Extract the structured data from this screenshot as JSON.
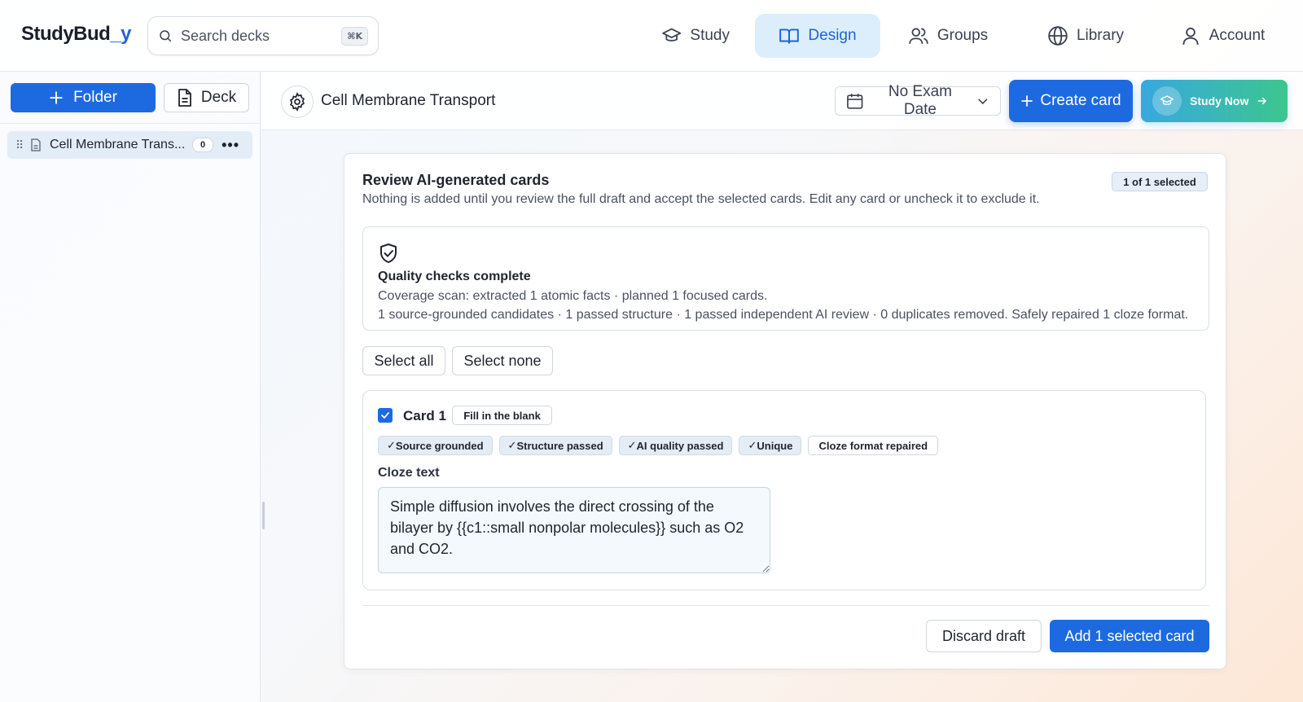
{
  "brand": {
    "prefix": "StudyBud",
    "accent": "_y"
  },
  "search": {
    "placeholder": "Search decks",
    "shortcut": "⌘K"
  },
  "nav": {
    "study": "Study",
    "design": "Design",
    "groups": "Groups",
    "library": "Library",
    "account": "Account",
    "active": "Design"
  },
  "sidebar": {
    "folder_label": "Folder",
    "deck_label": "Deck",
    "decks": [
      {
        "name": "Cell Membrane Trans...",
        "count": "0"
      }
    ]
  },
  "header": {
    "deck_title": "Cell Membrane Transport",
    "exam_date": "No Exam Date",
    "create_card": "Create card",
    "study_now": "Study Now"
  },
  "review": {
    "title": "Review AI-generated cards",
    "subtitle": "Nothing is added until you review the full draft and accept the selected cards. Edit any card or uncheck it to exclude it.",
    "selected_badge": "1 of 1 selected",
    "quality": {
      "title": "Quality checks complete",
      "line1": "Coverage scan: extracted 1 atomic facts · planned 1 focused cards.",
      "line2": "1 source-grounded candidates · 1 passed structure · 1 passed independent AI review · 0 duplicates removed. Safely repaired 1 cloze format."
    },
    "select_all": "Select all",
    "select_none": "Select none",
    "cards": [
      {
        "label": "Card 1",
        "type": "Fill in the blank",
        "checked": true,
        "tags": [
          "Source grounded",
          "Structure passed",
          "AI quality passed",
          "Unique",
          "Cloze format repaired"
        ],
        "field_label": "Cloze text",
        "text": "Simple diffusion involves the direct crossing of the bilayer by {{c1::small nonpolar molecules}} such as O2 and CO2."
      }
    ],
    "discard": "Discard draft",
    "add": "Add 1 selected card"
  },
  "colors": {
    "primary": "#1d6ae0",
    "accent_active_bg": "#dceefc",
    "study_now_start": "#38a8e0",
    "study_now_end": "#3cc68e"
  }
}
